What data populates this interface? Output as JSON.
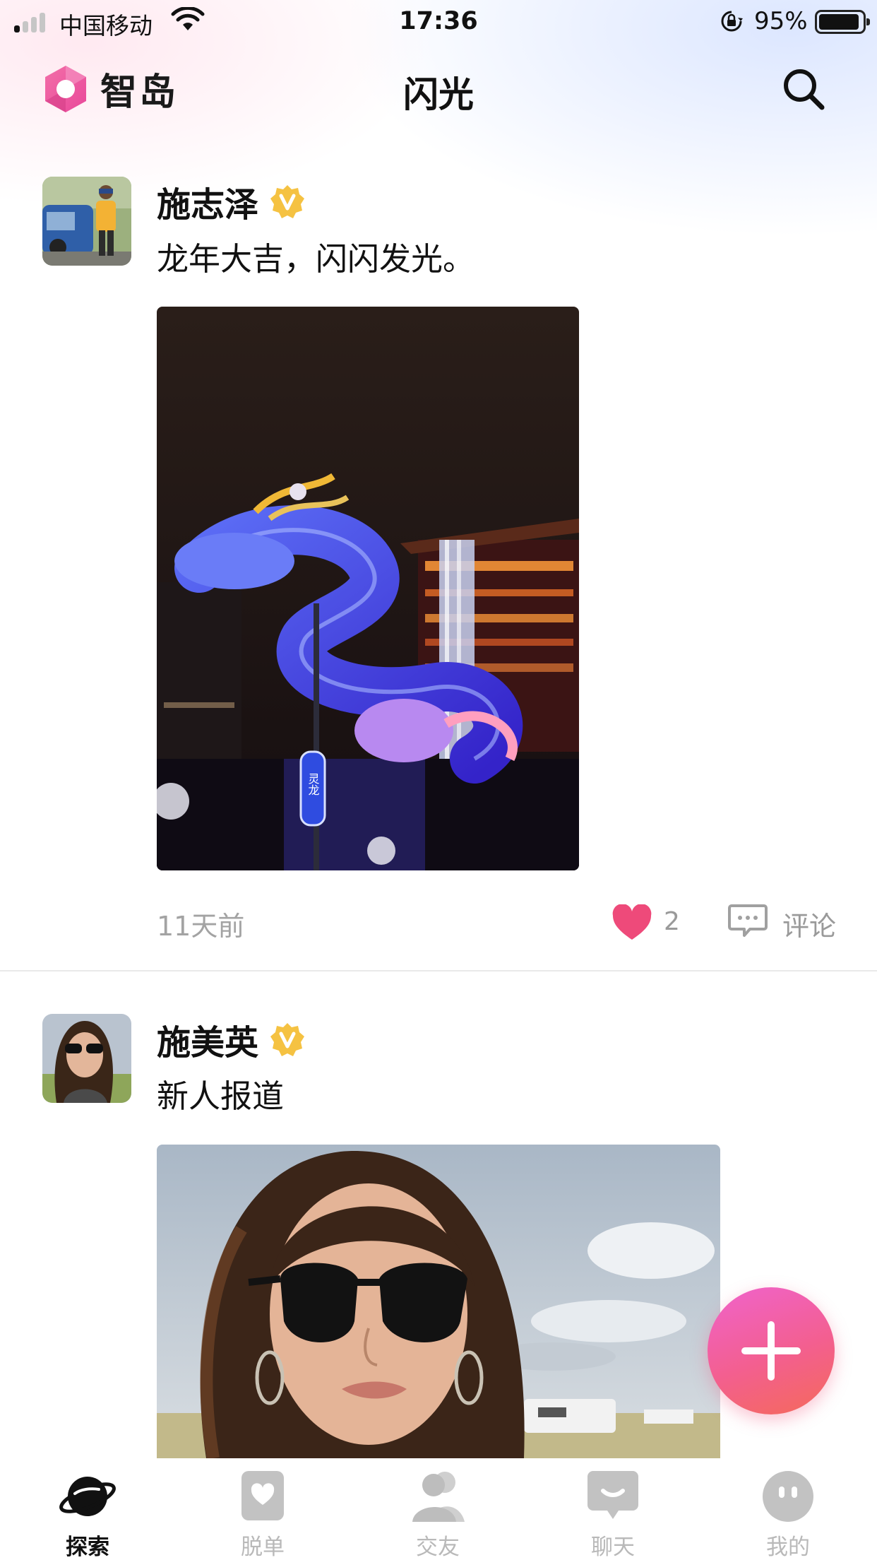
{
  "status_bar": {
    "carrier": "中国移动",
    "time": "17:36",
    "battery_percent": "95%",
    "battery_level": 0.95,
    "signal_bars_active": 1
  },
  "nav": {
    "brand_name": "智岛",
    "title": "闪光"
  },
  "posts": [
    {
      "username": "施志泽",
      "text": "龙年大吉，闪闪发光。",
      "time": "11天前",
      "like_count": "2",
      "comment_label": "评论"
    },
    {
      "username": "施美英",
      "text": "新人报道"
    }
  ],
  "image_signs": {
    "lantern_sign": "灵龙"
  },
  "tabs": [
    {
      "label": "探索",
      "icon": "planet-icon",
      "active": true
    },
    {
      "label": "脱单",
      "icon": "heart-card-icon",
      "active": false
    },
    {
      "label": "交友",
      "icon": "friends-icon",
      "active": false
    },
    {
      "label": "聊天",
      "icon": "chat-bubble-icon",
      "active": false
    },
    {
      "label": "我的",
      "icon": "face-icon",
      "active": false
    }
  ],
  "colors": {
    "accent_pink": "#f0507f",
    "brand_gradient_start": "#f063cc",
    "brand_gradient_end": "#f46a5a",
    "verified_badge": "#f5c242",
    "like_heart": "#ee4a7a",
    "muted_text": "#a3a3a3"
  }
}
